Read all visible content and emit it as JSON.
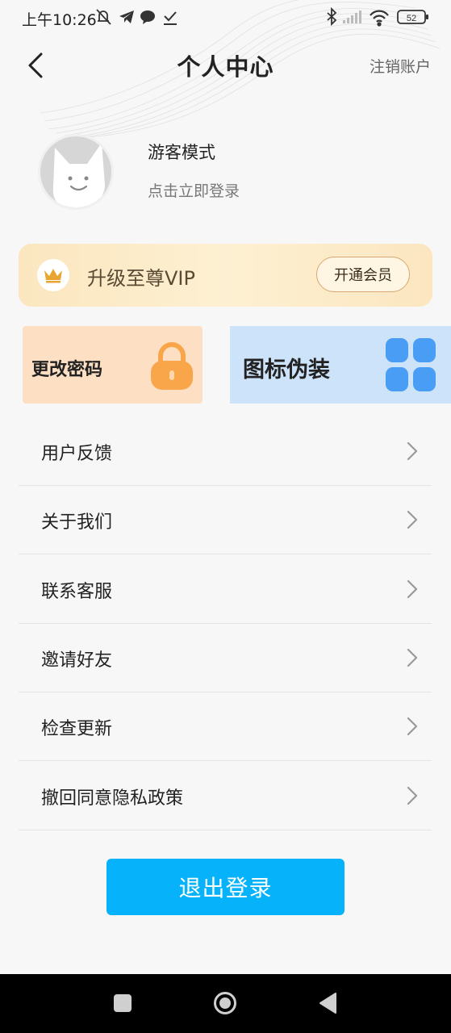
{
  "status_bar": {
    "time": "上午10:26",
    "battery": "52",
    "icons": [
      "mute-bell-icon",
      "telegram-icon",
      "chat-bubble-icon",
      "download-done-icon",
      "bluetooth-icon",
      "signal-icon",
      "wifi-icon",
      "battery-icon"
    ]
  },
  "header": {
    "title": "个人中心",
    "right_action": "注销账户"
  },
  "profile": {
    "name": "游客模式",
    "subtitle": "点击立即登录"
  },
  "vip": {
    "text": "升级至尊VIP",
    "button": "开通会员",
    "colors": {
      "banner": "#fbe6bf",
      "button_border": "#d9a774"
    }
  },
  "cards": {
    "password": {
      "label": "更改密码",
      "color": "#fde0c4",
      "icon_color": "#f9a54a"
    },
    "icon_disguise": {
      "label": "图标伪装",
      "color": "#cde3fa",
      "icon_color": "#4a9df5"
    }
  },
  "menu": [
    {
      "label": "用户反馈"
    },
    {
      "label": "关于我们"
    },
    {
      "label": "联系客服"
    },
    {
      "label": "邀请好友"
    },
    {
      "label": "检查更新"
    },
    {
      "label": "撤回同意隐私政策"
    }
  ],
  "logout_button": "退出登录",
  "accent_color": "#06b3fb"
}
